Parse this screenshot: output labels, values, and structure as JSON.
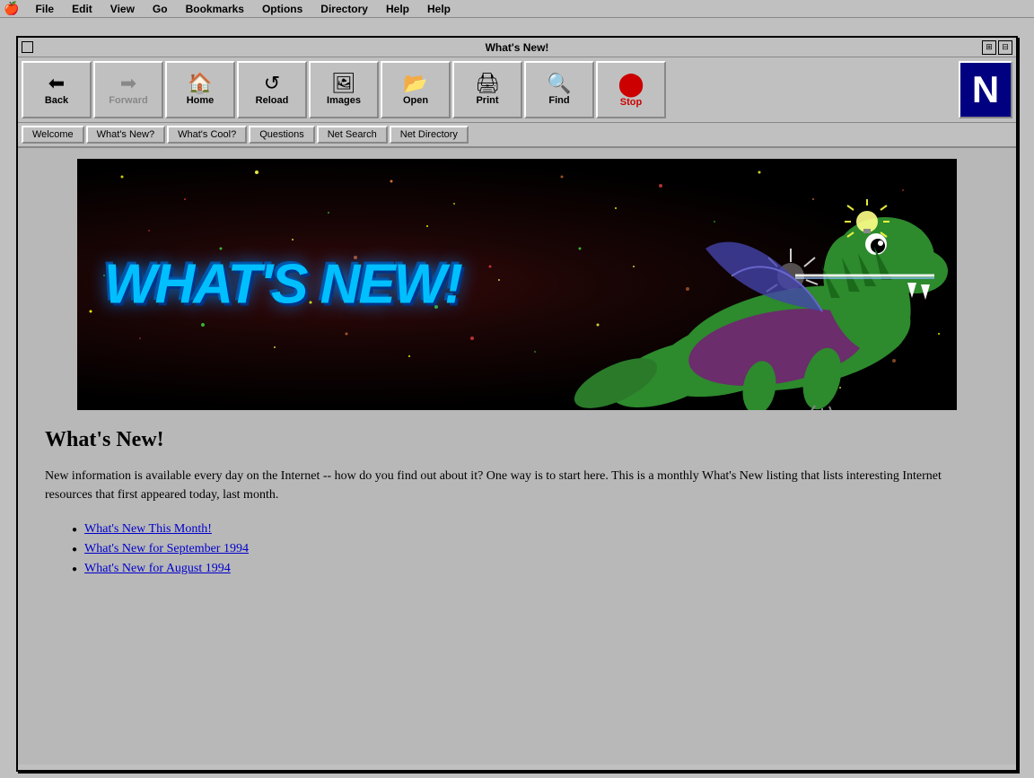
{
  "menubar": {
    "apple": "🍎",
    "items": [
      {
        "label": "File"
      },
      {
        "label": "Edit"
      },
      {
        "label": "View"
      },
      {
        "label": "Go"
      },
      {
        "label": "Bookmarks"
      },
      {
        "label": "Options"
      },
      {
        "label": "Directory"
      },
      {
        "label": "Help"
      },
      {
        "label": "Help"
      }
    ]
  },
  "titlebar": {
    "title": "What's New!",
    "close_label": "",
    "zoom_label": "⊞",
    "minimize_label": "⊟"
  },
  "toolbar": {
    "buttons": [
      {
        "id": "back",
        "label": "Back",
        "icon": "⬅",
        "disabled": false
      },
      {
        "id": "forward",
        "label": "Forward",
        "icon": "➡",
        "disabled": true
      },
      {
        "id": "home",
        "label": "Home",
        "icon": "🏠",
        "disabled": false
      },
      {
        "id": "reload",
        "label": "Reload",
        "icon": "↺",
        "disabled": false
      },
      {
        "id": "images",
        "label": "Images",
        "icon": "🖼",
        "disabled": false
      },
      {
        "id": "open",
        "label": "Open",
        "icon": "📂",
        "disabled": false
      },
      {
        "id": "print",
        "label": "Print",
        "icon": "🖨",
        "disabled": false
      },
      {
        "id": "find",
        "label": "Find",
        "icon": "🔍",
        "disabled": false
      },
      {
        "id": "stop",
        "label": "Stop",
        "icon": "⬤",
        "disabled": false
      }
    ],
    "logo": "N"
  },
  "bookmarkbar": {
    "buttons": [
      {
        "id": "welcome",
        "label": "Welcome"
      },
      {
        "id": "whats-new",
        "label": "What's New?"
      },
      {
        "id": "whats-cool",
        "label": "What's Cool?"
      },
      {
        "id": "questions",
        "label": "Questions"
      },
      {
        "id": "net-search",
        "label": "Net Search"
      },
      {
        "id": "net-directory",
        "label": "Net Directory"
      }
    ]
  },
  "page": {
    "banner_text": "WHAT'S NEW!",
    "title": "What's New!",
    "body_text": "New information is available every day on the Internet -- how do you find out about it? One way is to start here. This is a monthly What's New listing that lists interesting Internet resources that first appeared today, last month.",
    "links": [
      {
        "label": "What's New This Month!"
      },
      {
        "label": "What's New for September 1994"
      },
      {
        "label": "What's New for August 1994"
      }
    ]
  }
}
